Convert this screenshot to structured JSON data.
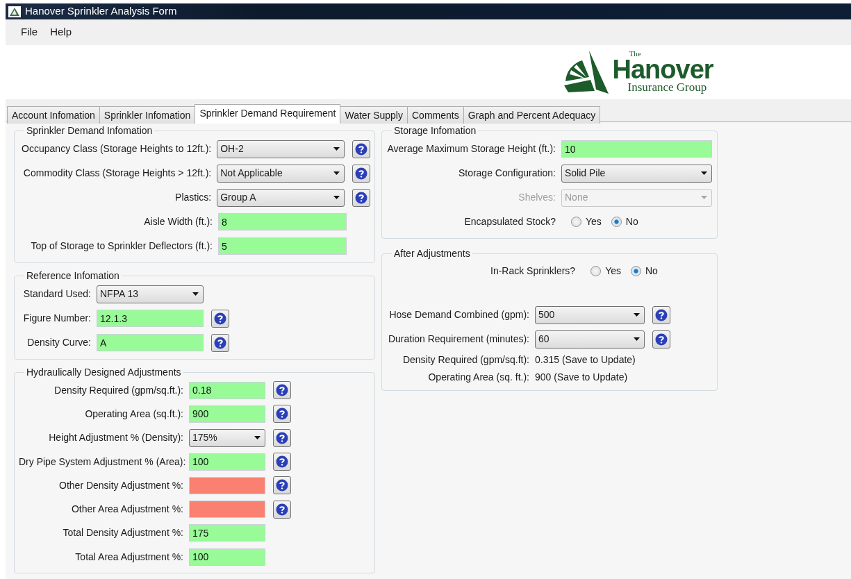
{
  "window": {
    "title": "Hanover Sprinkler Analysis Form"
  },
  "menu": [
    {
      "label": "File"
    },
    {
      "label": "Help"
    }
  ],
  "logo": {
    "small": "The",
    "name": "Hanover",
    "tagline": "Insurance Group"
  },
  "tabs": [
    {
      "label": "Account Infomation",
      "selected": false
    },
    {
      "label": "Sprinkler Infomation",
      "selected": false
    },
    {
      "label": "Sprinkler Demand Requirement",
      "selected": true
    },
    {
      "label": "Water Supply",
      "selected": false
    },
    {
      "label": "Comments",
      "selected": false
    },
    {
      "label": "Graph and Percent Adequacy",
      "selected": false
    }
  ],
  "panels": {
    "left": [
      {
        "title": "Sprinkler Demand Infomation",
        "rows": [
          {
            "kind": "select",
            "label": "Occupancy Class (Storage Heights to 12ft.):",
            "value": "OH-2",
            "help": true,
            "disabled": false
          },
          {
            "kind": "select",
            "label": "Commodity Class (Storage Heights > 12ft.):",
            "value": "Not Applicable",
            "help": true,
            "disabled": false
          },
          {
            "kind": "select",
            "label": "Plastics:",
            "value": "Group A",
            "help": true,
            "disabled": false
          },
          {
            "kind": "input",
            "label": "Aisle Width (ft.):",
            "value": "8",
            "color": "#98fb98",
            "help": false
          },
          {
            "kind": "input",
            "label": "Top of Storage to Sprinkler Deflectors (ft.):",
            "value": "5",
            "color": "#98fb98",
            "help": false
          }
        ]
      },
      {
        "title": "Reference Infomation",
        "rows": [
          {
            "kind": "select",
            "label": "Standard Used:",
            "value": "NFPA 13",
            "help": false,
            "disabled": false
          },
          {
            "kind": "input",
            "label": "Figure Number:",
            "value": "12.1.3",
            "color": "#98fb98",
            "help": true
          },
          {
            "kind": "input",
            "label": "Density Curve:",
            "value": "A",
            "color": "#98fb98",
            "help": true
          }
        ]
      },
      {
        "title": "Hydraulically Designed Adjustments",
        "rows": [
          {
            "kind": "input",
            "label": "Density Required (gpm/sq.ft.):",
            "value": "0.18",
            "color": "#98fb98",
            "help": true
          },
          {
            "kind": "input",
            "label": "Operating Area (sq.ft.):",
            "value": "900",
            "color": "#98fb98",
            "help": true
          },
          {
            "kind": "select",
            "label": "Height Adjustment % (Density):",
            "value": "175%",
            "help": true,
            "disabled": false
          },
          {
            "kind": "input",
            "label": "Dry Pipe System Adjustment % (Area):",
            "value": "100",
            "color": "#98fb98",
            "help": true
          },
          {
            "kind": "input",
            "label": "Other Density Adjustment %:",
            "color": "#fa8072",
            "help": true
          },
          {
            "kind": "input",
            "label": "Other Area Adjustment %:",
            "color": "#fa8072",
            "help": true
          },
          {
            "kind": "input",
            "label": "Total Density Adjustment %:",
            "value": "175",
            "color": "#98fb98",
            "help": false
          },
          {
            "kind": "input",
            "label": "Total Area Adjustment %:",
            "value": "100",
            "color": "#98fb98",
            "help": false
          }
        ]
      }
    ],
    "right": [
      {
        "title": "Storage Infomation",
        "rows": [
          {
            "kind": "input",
            "label": "Average Maximum Storage Height (ft.):",
            "value": "10",
            "color": "#98fb98",
            "help": false
          },
          {
            "kind": "select",
            "label": "Storage Configuration:",
            "value": "Solid Pile",
            "help": false,
            "disabled": false
          },
          {
            "kind": "select",
            "label": "Shelves:",
            "value": "None",
            "help": false,
            "disabled": true
          },
          {
            "kind": "radio",
            "label": "Encapsulated Stock?",
            "options": [
              {
                "label": "Yes",
                "selected": false
              },
              {
                "label": "No",
                "selected": true
              }
            ]
          }
        ]
      },
      {
        "title": "After Adjustments",
        "rows": [
          {
            "kind": "radio",
            "label": "In-Rack Sprinklers?",
            "options": [
              {
                "label": "Yes",
                "selected": false
              },
              {
                "label": "No",
                "selected": true
              }
            ]
          },
          {
            "kind": "select",
            "label": "Hose Demand Combined (gpm):",
            "value": "500",
            "help": true,
            "disabled": false
          },
          {
            "kind": "select",
            "label": "Duration Requirement (minutes):",
            "value": "60",
            "help": true,
            "disabled": false
          },
          {
            "kind": "readout",
            "label": "Density Required (gpm/sq.ft):",
            "value": "0.315 (Save to Update)"
          },
          {
            "kind": "readout",
            "label": "Operating Area (sq. ft.):",
            "value": "900 (Save to Update)"
          }
        ]
      }
    ]
  }
}
